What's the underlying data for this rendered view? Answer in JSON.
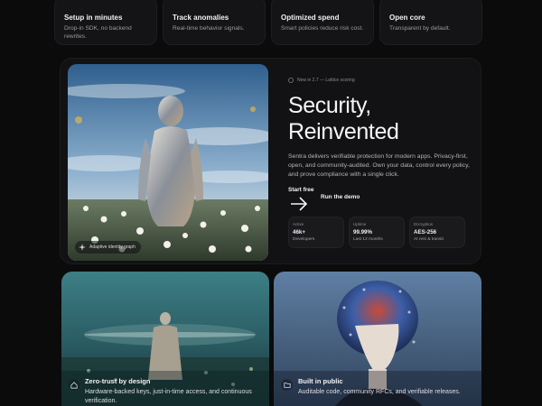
{
  "features": [
    {
      "title": "Setup in minutes",
      "desc": "Drop-in SDK, no backend rewrites."
    },
    {
      "title": "Track anomalies",
      "desc": "Real-time behavior signals."
    },
    {
      "title": "Optimized spend",
      "desc": "Smart policies reduce risk cost."
    },
    {
      "title": "Open core",
      "desc": "Transparent by default."
    }
  ],
  "hero": {
    "image_badge": "Adaptive identity graph",
    "pill": "New in 2.7 — Lattice scoring",
    "title_line1": "Security,",
    "title_line2": "Reinvented",
    "description": "Sentra delivers verifiable protection for modern apps. Privacy-first, open, and community-audited. Own your data, control every policy, and prove compliance with a single click.",
    "cta_primary": "Start free",
    "cta_secondary": "Run the demo",
    "stats": [
      {
        "label": "Active",
        "value": "46k+",
        "sub": "Developers"
      },
      {
        "label": "Uptime",
        "value": "99.99%",
        "sub": "Last 12 months"
      },
      {
        "label": "Encryption",
        "value": "AES-256",
        "sub": "At rest & transit"
      }
    ]
  },
  "cards": [
    {
      "title": "Zero-trust by design",
      "desc": "Hardware-backed keys, just-in-time access, and continuous verification.",
      "icon": "home-shield-icon"
    },
    {
      "title": "Built in public",
      "desc": "Auditable code, community RFCs, and verifiable releases.",
      "icon": "folder-icon"
    }
  ]
}
